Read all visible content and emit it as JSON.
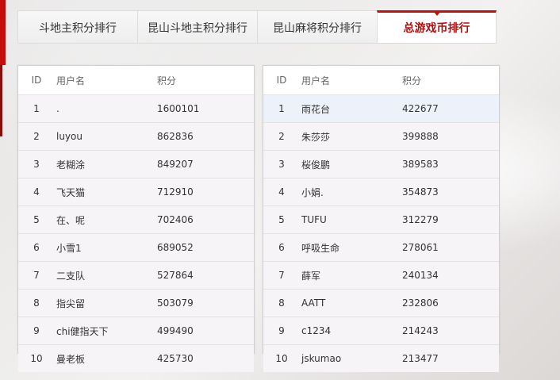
{
  "tabs": [
    {
      "label": "斗地主积分排行",
      "active": false
    },
    {
      "label": "昆山斗地主积分排行",
      "active": false
    },
    {
      "label": "昆山麻将积分排行",
      "active": false
    },
    {
      "label": "总游戏币排行",
      "active": true
    }
  ],
  "left_table": {
    "headers": {
      "id": "ID",
      "name": "用户名",
      "score": "积分"
    },
    "rows": [
      {
        "id": "1",
        "name": ".",
        "score": "1600101"
      },
      {
        "id": "2",
        "name": "luyou",
        "score": "862836"
      },
      {
        "id": "3",
        "name": "老糊涂",
        "score": "849207"
      },
      {
        "id": "4",
        "name": "飞天猫",
        "score": "712910"
      },
      {
        "id": "5",
        "name": "在、呢",
        "score": "702406"
      },
      {
        "id": "6",
        "name": "小雪1",
        "score": "689052"
      },
      {
        "id": "7",
        "name": "二支队",
        "score": "527864"
      },
      {
        "id": "8",
        "name": "指尖留",
        "score": "503079"
      },
      {
        "id": "9",
        "name": "chi健指天下",
        "score": "499490"
      },
      {
        "id": "10",
        "name": "曼老板",
        "score": "425730"
      }
    ]
  },
  "right_table": {
    "headers": {
      "id": "ID",
      "name": "用户名",
      "score": "积分"
    },
    "rows": [
      {
        "id": "1",
        "name": "雨花台",
        "score": "422677"
      },
      {
        "id": "2",
        "name": "朱莎莎",
        "score": "399888"
      },
      {
        "id": "3",
        "name": "桜俊鹏",
        "score": "389583"
      },
      {
        "id": "4",
        "name": "小娟.",
        "score": "354873"
      },
      {
        "id": "5",
        "name": "TUFU",
        "score": "312279"
      },
      {
        "id": "6",
        "name": "呼吸生命",
        "score": "278061"
      },
      {
        "id": "7",
        "name": "薛军",
        "score": "240134"
      },
      {
        "id": "8",
        "name": "AATT",
        "score": "232806"
      },
      {
        "id": "9",
        "name": "c1234",
        "score": "214243"
      },
      {
        "id": "10",
        "name": "jskumao",
        "score": "213477"
      }
    ]
  },
  "colors": {
    "accent": "#c40d0d",
    "active_tab_text": "#b40c0c",
    "row_bg": "#f6f4f6",
    "row_highlight": "#ecf1fa"
  }
}
